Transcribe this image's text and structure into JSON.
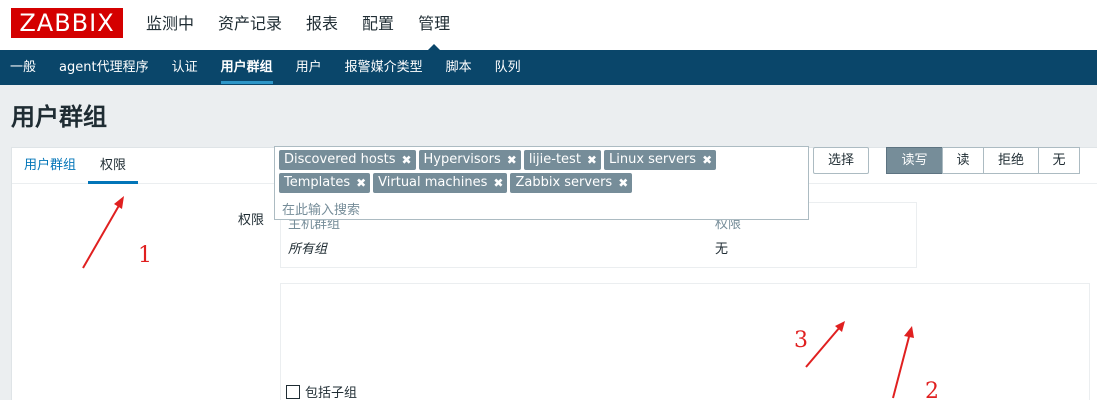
{
  "brand": {
    "logo_text": "ZABBIX"
  },
  "main_nav": [
    {
      "label": "监测中"
    },
    {
      "label": "资产记录"
    },
    {
      "label": "报表"
    },
    {
      "label": "配置"
    },
    {
      "label": "管理",
      "active": true
    }
  ],
  "sub_nav": [
    {
      "label": "一般"
    },
    {
      "label": "agent代理程序"
    },
    {
      "label": "认证"
    },
    {
      "label": "用户群组",
      "active": true
    },
    {
      "label": "用户"
    },
    {
      "label": "报警媒介类型"
    },
    {
      "label": "脚本"
    },
    {
      "label": "队列"
    }
  ],
  "page": {
    "title": "用户群组"
  },
  "tabs": [
    {
      "label": "用户群组"
    },
    {
      "label": "权限",
      "active": true
    }
  ],
  "permissions": {
    "label": "权限",
    "table": {
      "headers": {
        "host_group": "主机群组",
        "permission": "权限"
      },
      "rows": [
        {
          "host_group": "所有组",
          "permission": "无"
        }
      ]
    }
  },
  "selector": {
    "chips": [
      "Discovered hosts",
      "Hypervisors",
      "lijie-test",
      "Linux servers",
      "Templates",
      "Virtual machines",
      "Zabbix servers"
    ],
    "placeholder": "在此输入搜索",
    "select_button": "选择",
    "permission_options": [
      {
        "label": "读写",
        "active": true
      },
      {
        "label": "读"
      },
      {
        "label": "拒绝"
      },
      {
        "label": "无"
      }
    ],
    "include_subgroups": "包括子组",
    "remove_glyph": "✖"
  },
  "annotations": [
    "1",
    "2",
    "3"
  ],
  "colors": {
    "brand_red": "#d40000",
    "subnav_bg": "#0a466a",
    "chip_bg": "#768d99",
    "annotation": "#e02020"
  }
}
